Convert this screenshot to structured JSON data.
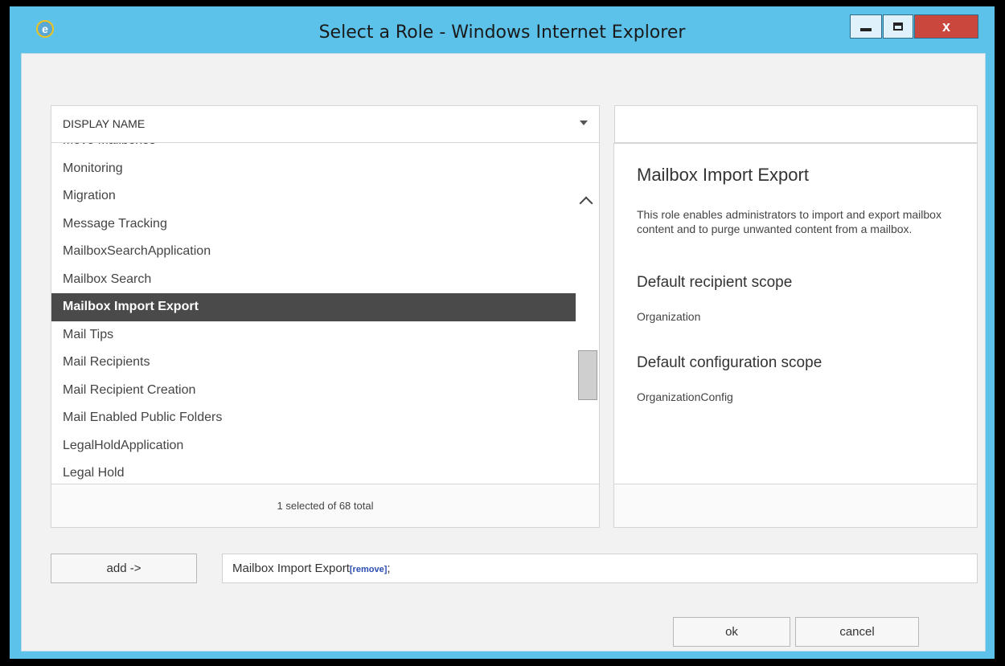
{
  "window": {
    "title": "Select a Role - Windows Internet Explorer",
    "close_glyph": "x"
  },
  "list": {
    "header_label": "DISPLAY NAME",
    "items": [
      "Move Mailboxes",
      "Monitoring",
      "Migration",
      "Message Tracking",
      "MailboxSearchApplication",
      "Mailbox Search",
      "Mailbox Import Export",
      "Mail Tips",
      "Mail Recipients",
      "Mail Recipient Creation",
      "Mail Enabled Public Folders",
      "LegalHoldApplication",
      "Legal Hold"
    ],
    "selected_item": "Mailbox Import Export",
    "footer_status": "1 selected of 68 total"
  },
  "details": {
    "title": "Mailbox Import Export",
    "description": "This role enables administrators to import and export mailbox content and to purge unwanted content from a mailbox.",
    "recipient_scope_heading": "Default recipient scope",
    "recipient_scope_value": "Organization",
    "config_scope_heading": "Default configuration scope",
    "config_scope_value": "OrganizationConfig"
  },
  "actions": {
    "add_label": "add ->",
    "selected_value": "Mailbox Import Export",
    "remove_label": "[remove]",
    "separator": ";",
    "ok_label": "ok",
    "cancel_label": "cancel"
  },
  "icons": {
    "app_icon": "internet-explorer-icon",
    "minimize_icon": "minimize-icon",
    "maximize_icon": "maximize-icon",
    "close_icon": "close-icon",
    "sort_icon": "chevron-down-icon",
    "scroll_up_icon": "chevron-up-icon",
    "scroll_down_icon": "chevron-down-icon"
  },
  "colors": {
    "frame": "#5cc2ea",
    "close_button": "#c9473c",
    "selected_row": "#4a4a4a",
    "link": "#2a4db0"
  }
}
